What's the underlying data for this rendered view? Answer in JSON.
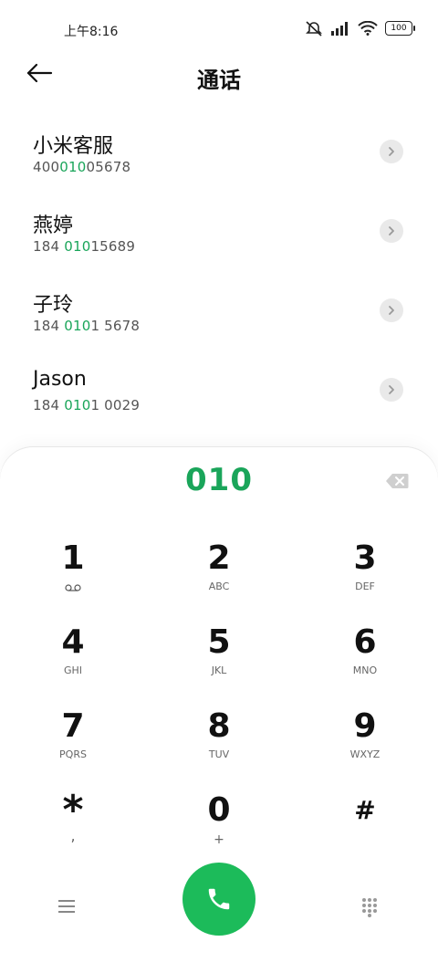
{
  "status": {
    "time": "上午8:16",
    "battery": "100"
  },
  "header": {
    "title": "通话"
  },
  "contacts": [
    {
      "name": "小米客服",
      "num_pre": "400",
      "num_match": "010",
      "num_post": "05678"
    },
    {
      "name": "燕婷",
      "num_pre": "184 ",
      "num_match": "010",
      "num_post": "15689"
    },
    {
      "name": "子玲",
      "num_pre": "184 ",
      "num_match": "010",
      "num_post": "1 5678"
    },
    {
      "name": "Jason",
      "num_pre": "184 ",
      "num_match": "010",
      "num_post": "1 0029"
    }
  ],
  "dialer": {
    "input": "010"
  },
  "keypad": [
    {
      "digit": "1",
      "letters": ""
    },
    {
      "digit": "2",
      "letters": "ABC"
    },
    {
      "digit": "3",
      "letters": "DEF"
    },
    {
      "digit": "4",
      "letters": "GHI"
    },
    {
      "digit": "5",
      "letters": "JKL"
    },
    {
      "digit": "6",
      "letters": "MNO"
    },
    {
      "digit": "7",
      "letters": "PQRS"
    },
    {
      "digit": "8",
      "letters": "TUV"
    },
    {
      "digit": "9",
      "letters": "WXYZ"
    },
    {
      "digit": "*",
      "letters": ","
    },
    {
      "digit": "0",
      "letters": "+"
    },
    {
      "digit": "#",
      "letters": ""
    }
  ],
  "colors": {
    "accent": "#1aa55a",
    "call": "#1cbb5a"
  },
  "icons": {
    "back": "arrow-left-icon",
    "detail": "chevron-right-icon",
    "backspace": "backspace-icon",
    "voicemail": "voicemail-icon",
    "menu": "menu-icon",
    "call": "phone-icon",
    "keypad": "dialpad-icon"
  }
}
